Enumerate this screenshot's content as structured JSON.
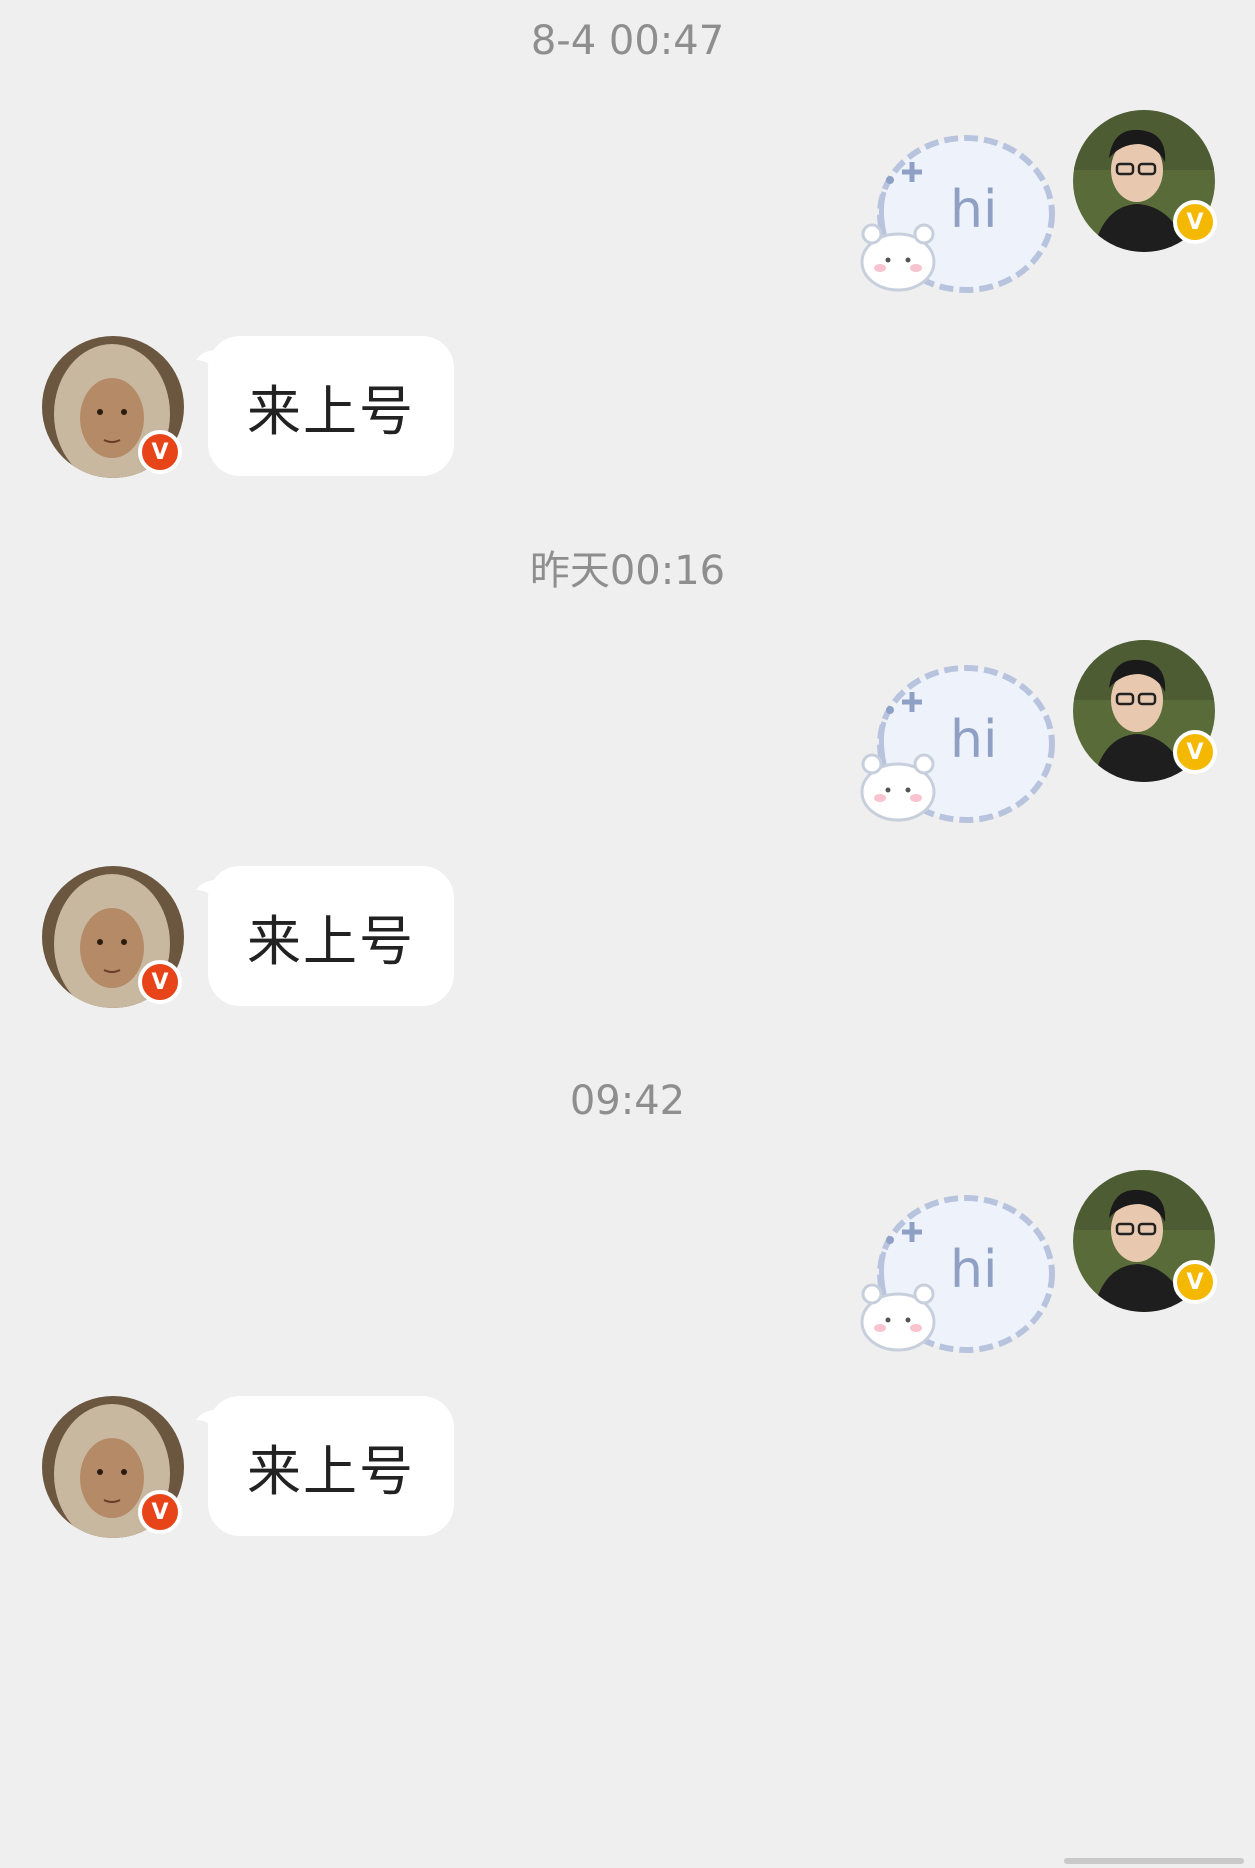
{
  "messages": {
    "timestamp_1": "8-4 00:47",
    "timestamp_2": "昨天00:16",
    "timestamp_3": "09:42",
    "sent_sticker_text": "hi",
    "received_text": "来上号",
    "badge_letter": "V"
  },
  "colors": {
    "background": "#efefef",
    "bubble": "#ffffff",
    "timestamp": "#8e8e8e",
    "badge_sent": "#f5b800",
    "badge_received": "#e8441a",
    "sticker_text": "#8fa0c4"
  }
}
